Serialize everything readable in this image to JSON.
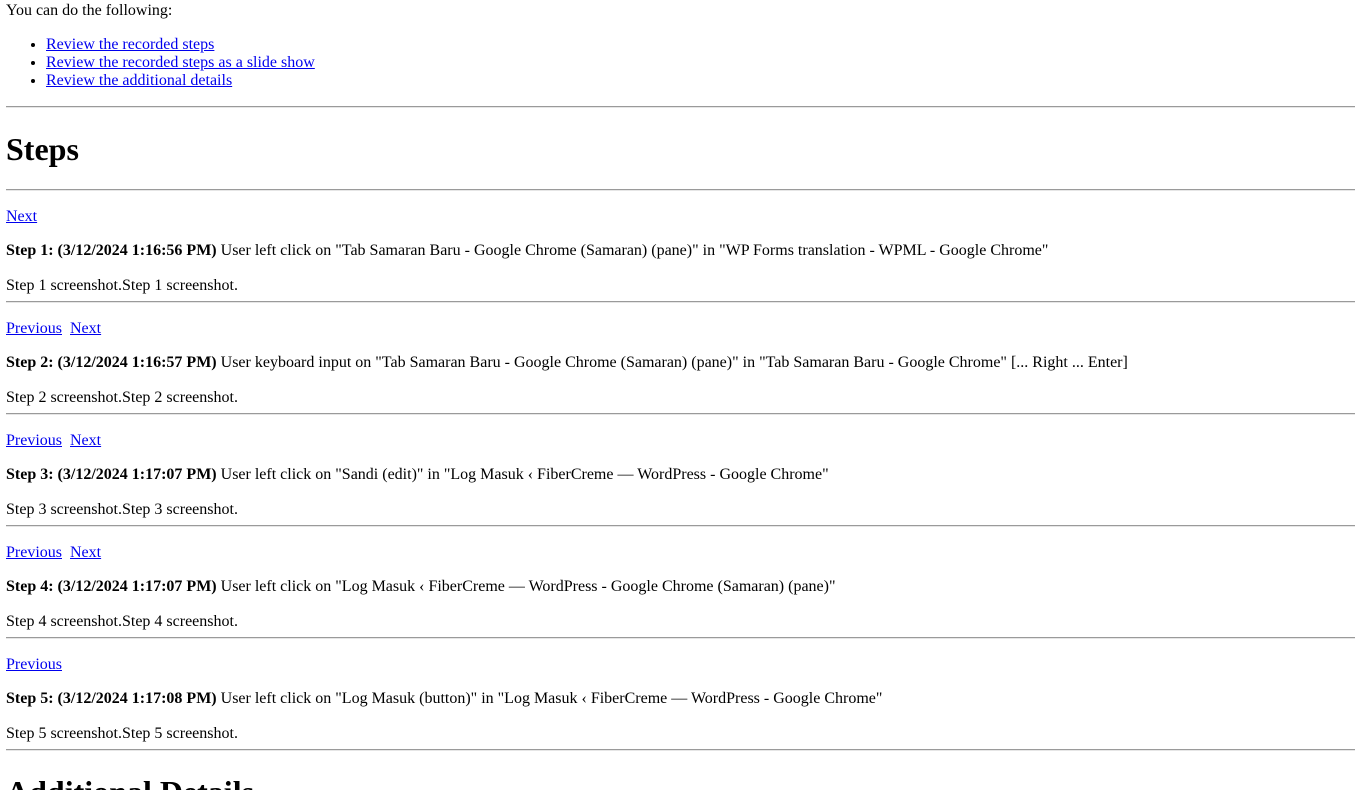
{
  "intro": "You can do the following:",
  "options": [
    "Review the recorded steps",
    "Review the recorded steps as a slide show",
    "Review the additional details"
  ],
  "steps_heading": "Steps",
  "nav": {
    "previous": "Previous",
    "next": "Next"
  },
  "steps": [
    {
      "label": "Step 1: (3/12/2024 1:16:56 PM)",
      "text": " User left click on \"Tab Samaran Baru - Google Chrome (Samaran) (pane)\" in \"WP Forms translation - WPML - Google Chrome\"",
      "alt": "Step 1 screenshot.Step 1 screenshot."
    },
    {
      "label": "Step 2: (3/12/2024 1:16:57 PM)",
      "text": " User keyboard input on \"Tab Samaran Baru - Google Chrome (Samaran) (pane)\" in \"Tab Samaran Baru - Google Chrome\" [... Right ... Enter]",
      "alt": "Step 2 screenshot.Step 2 screenshot."
    },
    {
      "label": "Step 3: (3/12/2024 1:17:07 PM)",
      "text": " User left click on \"Sandi (edit)\" in \"Log Masuk ‹ FiberCreme — WordPress - Google Chrome\"",
      "alt": "Step 3 screenshot.Step 3 screenshot."
    },
    {
      "label": "Step 4: (3/12/2024 1:17:07 PM)",
      "text": " User left click on \"Log Masuk ‹ FiberCreme — WordPress - Google Chrome (Samaran) (pane)\"",
      "alt": "Step 4 screenshot.Step 4 screenshot."
    },
    {
      "label": "Step 5: (3/12/2024 1:17:08 PM)",
      "text": " User left click on \"Log Masuk (button)\" in \"Log Masuk ‹ FiberCreme — WordPress - Google Chrome\"",
      "alt": "Step 5 screenshot.Step 5 screenshot."
    }
  ],
  "additional_heading": "Additional Details"
}
